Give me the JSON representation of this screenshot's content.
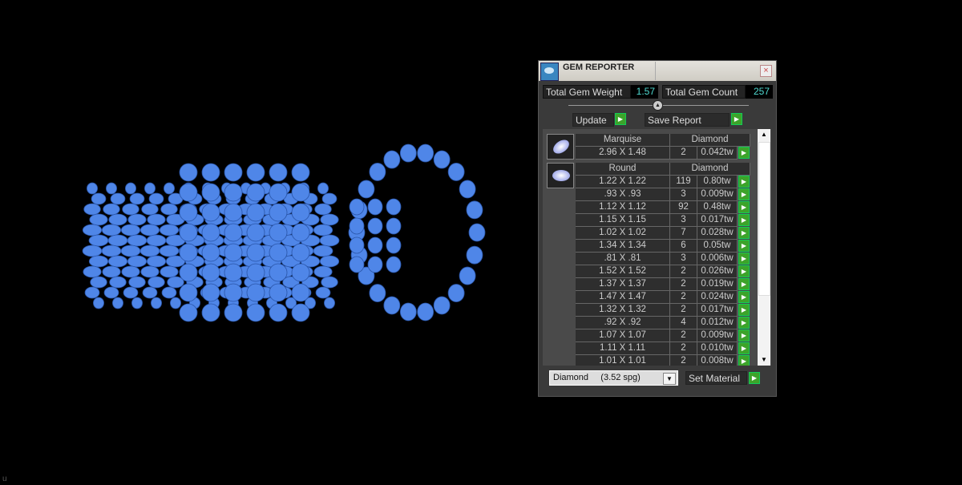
{
  "viewport": {
    "corner_text": "u",
    "gem_color": "#4f86e8"
  },
  "panel": {
    "title": "GEM REPORTER",
    "close": "×",
    "total_weight_label": "Total Gem Weight",
    "total_weight": "1.57",
    "total_count_label": "Total Gem Count",
    "total_count": "257",
    "update_label": "Update",
    "save_report_label": "Save Report",
    "groups": [
      {
        "shape": "Marquise",
        "material": "Diamond",
        "icon": "marquise-gem-icon",
        "rows": [
          {
            "size": "2.96 X 1.48",
            "count": "2",
            "weight": "0.042tw"
          }
        ]
      },
      {
        "shape": "Round",
        "material": "Diamond",
        "icon": "round-gem-icon",
        "rows": [
          {
            "size": "1.22 X 1.22",
            "count": "119",
            "weight": "0.80tw"
          },
          {
            "size": ".93 X .93",
            "count": "3",
            "weight": "0.009tw"
          },
          {
            "size": "1.12 X 1.12",
            "count": "92",
            "weight": "0.48tw"
          },
          {
            "size": "1.15 X 1.15",
            "count": "3",
            "weight": "0.017tw"
          },
          {
            "size": "1.02 X 1.02",
            "count": "7",
            "weight": "0.028tw"
          },
          {
            "size": "1.34 X 1.34",
            "count": "6",
            "weight": "0.05tw"
          },
          {
            "size": ".81 X .81",
            "count": "3",
            "weight": "0.006tw"
          },
          {
            "size": "1.52 X 1.52",
            "count": "2",
            "weight": "0.026tw"
          },
          {
            "size": "1.37 X 1.37",
            "count": "2",
            "weight": "0.019tw"
          },
          {
            "size": "1.47 X 1.47",
            "count": "2",
            "weight": "0.024tw"
          },
          {
            "size": "1.32 X 1.32",
            "count": "2",
            "weight": "0.017tw"
          },
          {
            "size": ".92 X .92",
            "count": "4",
            "weight": "0.012tw"
          },
          {
            "size": "1.07 X 1.07",
            "count": "2",
            "weight": "0.009tw"
          },
          {
            "size": "1.11 X 1.11",
            "count": "2",
            "weight": "0.010tw"
          },
          {
            "size": "1.01 X 1.01",
            "count": "2",
            "weight": "0.008tw"
          }
        ]
      }
    ],
    "material_select": "Diamond     (3.52 spg)",
    "set_material_label": "Set Material"
  }
}
